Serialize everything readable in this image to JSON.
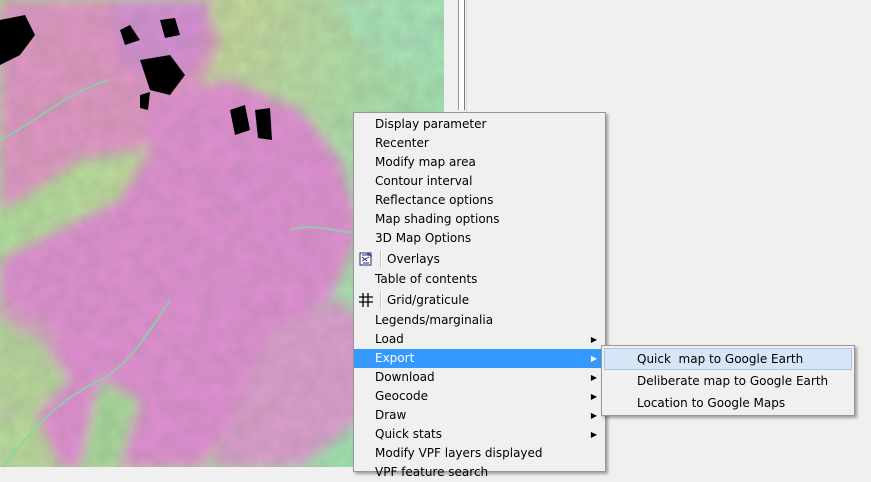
{
  "context_menu": {
    "items": [
      {
        "label": "Display parameter"
      },
      {
        "label": "Recenter"
      },
      {
        "label": "Modify map area"
      },
      {
        "label": "Contour interval"
      },
      {
        "label": "Reflectance options"
      },
      {
        "label": "Map shading options"
      },
      {
        "label": "3D Map Options"
      },
      {
        "label": "Overlays",
        "icon": "overlays-icon"
      },
      {
        "label": "Table of contents"
      },
      {
        "label": "Grid/graticule",
        "icon": "grid-icon"
      },
      {
        "label": "Legends/marginalia"
      },
      {
        "label": "Load",
        "submenu": true
      },
      {
        "label": "Export",
        "submenu": true,
        "active": true
      },
      {
        "label": "Download",
        "submenu": true
      },
      {
        "label": "Geocode",
        "submenu": true
      },
      {
        "label": "Draw",
        "submenu": true
      },
      {
        "label": "Quick stats",
        "submenu": true
      },
      {
        "label": "Modify VPF layers displayed"
      },
      {
        "label": "VPF feature search"
      }
    ]
  },
  "export_submenu": {
    "items": [
      {
        "label": "Quick  map to Google Earth",
        "hover": true
      },
      {
        "label": "Deliberate map to Google Earth"
      },
      {
        "label": "Location to Google Maps"
      }
    ]
  },
  "colors": {
    "menu_highlight": "#3399ff",
    "submenu_hover": "#d6e6f7",
    "map_green": "#9adf9c",
    "map_magenta": "#e58ad6"
  }
}
